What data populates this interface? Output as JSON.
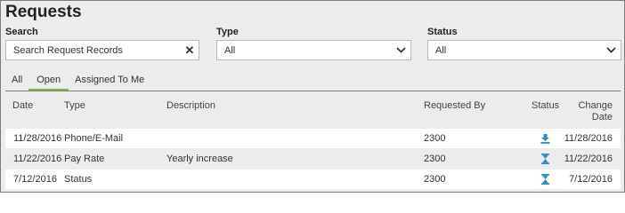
{
  "page": {
    "title": "Requests"
  },
  "filters": {
    "search": {
      "label": "Search",
      "value": "Search Request Records",
      "clear_icon": "close-icon"
    },
    "type": {
      "label": "Type",
      "value": "All",
      "icon": "chevron-down-icon"
    },
    "status": {
      "label": "Status",
      "value": "All",
      "icon": "chevron-down-icon"
    }
  },
  "tabs": [
    {
      "label": "All",
      "active": false
    },
    {
      "label": "Open",
      "active": true
    },
    {
      "label": "Assigned To Me",
      "active": false
    }
  ],
  "table": {
    "columns": {
      "date": "Date",
      "type": "Type",
      "description": "Description",
      "requested_by": "Requested By",
      "status": "Status",
      "change_date_line1": "Change",
      "change_date_line2": "Date"
    },
    "rows": [
      {
        "date": "11/28/2016",
        "type": "Phone/E-Mail",
        "description": "",
        "requested_by": "2300",
        "status_icon": "download-icon",
        "change_date": "11/28/2016"
      },
      {
        "date": "11/22/2016",
        "type": "Pay Rate",
        "description": "Yearly increase",
        "requested_by": "2300",
        "status_icon": "hourglass-icon",
        "change_date": "11/22/2016"
      },
      {
        "date": "7/12/2016",
        "type": "Status",
        "description": "",
        "requested_by": "2300",
        "status_icon": "hourglass-icon",
        "change_date": "7/12/2016"
      }
    ]
  },
  "colors": {
    "accent_tab": "#7ab648",
    "status_icon": "#2a8fc7"
  }
}
